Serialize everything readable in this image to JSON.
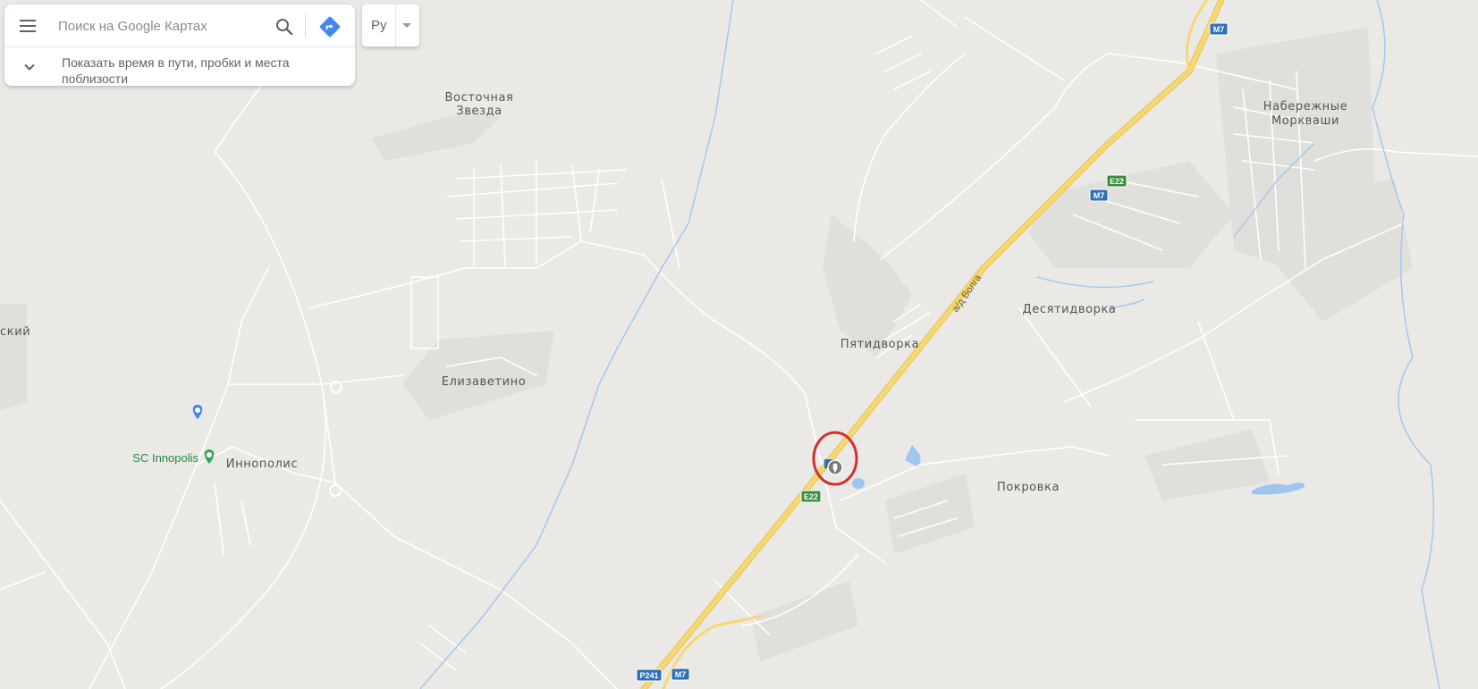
{
  "search": {
    "placeholder": "Поиск на Google Картах",
    "expand_text": "Показать время в пути, пробки и места поблизости"
  },
  "icons": {
    "menu": "menu-icon",
    "search": "search-icon",
    "directions": "directions-icon",
    "chevron": "chevron-down-icon"
  },
  "language": {
    "label": "Ру"
  },
  "places": [
    {
      "id": "vostochnaya-1",
      "label": "Восточная"
    },
    {
      "id": "vostochnaya-2",
      "label": "Звезда"
    },
    {
      "id": "naberezhnye-1",
      "label": "Набережные"
    },
    {
      "id": "naberezhnye-2",
      "label": "Моркваши"
    },
    {
      "id": "desyatidvorka",
      "label": "Десятидворка"
    },
    {
      "id": "pyatidvorka",
      "label": "Пятидворка"
    },
    {
      "id": "elizavetino",
      "label": "Елизаветино"
    },
    {
      "id": "innopolis",
      "label": "Иннополис"
    },
    {
      "id": "pokrovka",
      "label": "Покровка"
    },
    {
      "id": "edge-skiy",
      "label": "ский"
    }
  ],
  "poi": {
    "sc_innopolis": "SC Innopolis"
  },
  "road": {
    "name": "а/д Волга"
  },
  "shields": {
    "m7": "M7",
    "e22": "E22",
    "p241": "P241"
  },
  "colors": {
    "background": "#ebe9e6",
    "highway": "#f6d873",
    "water": "#9fc6f0",
    "m_shield": "#2f6fb7",
    "e_shield": "#3a8d3b",
    "marker_circle": "#d32f2f",
    "poi_green": "#1e8e3e",
    "poi_blue": "#4285f4"
  }
}
